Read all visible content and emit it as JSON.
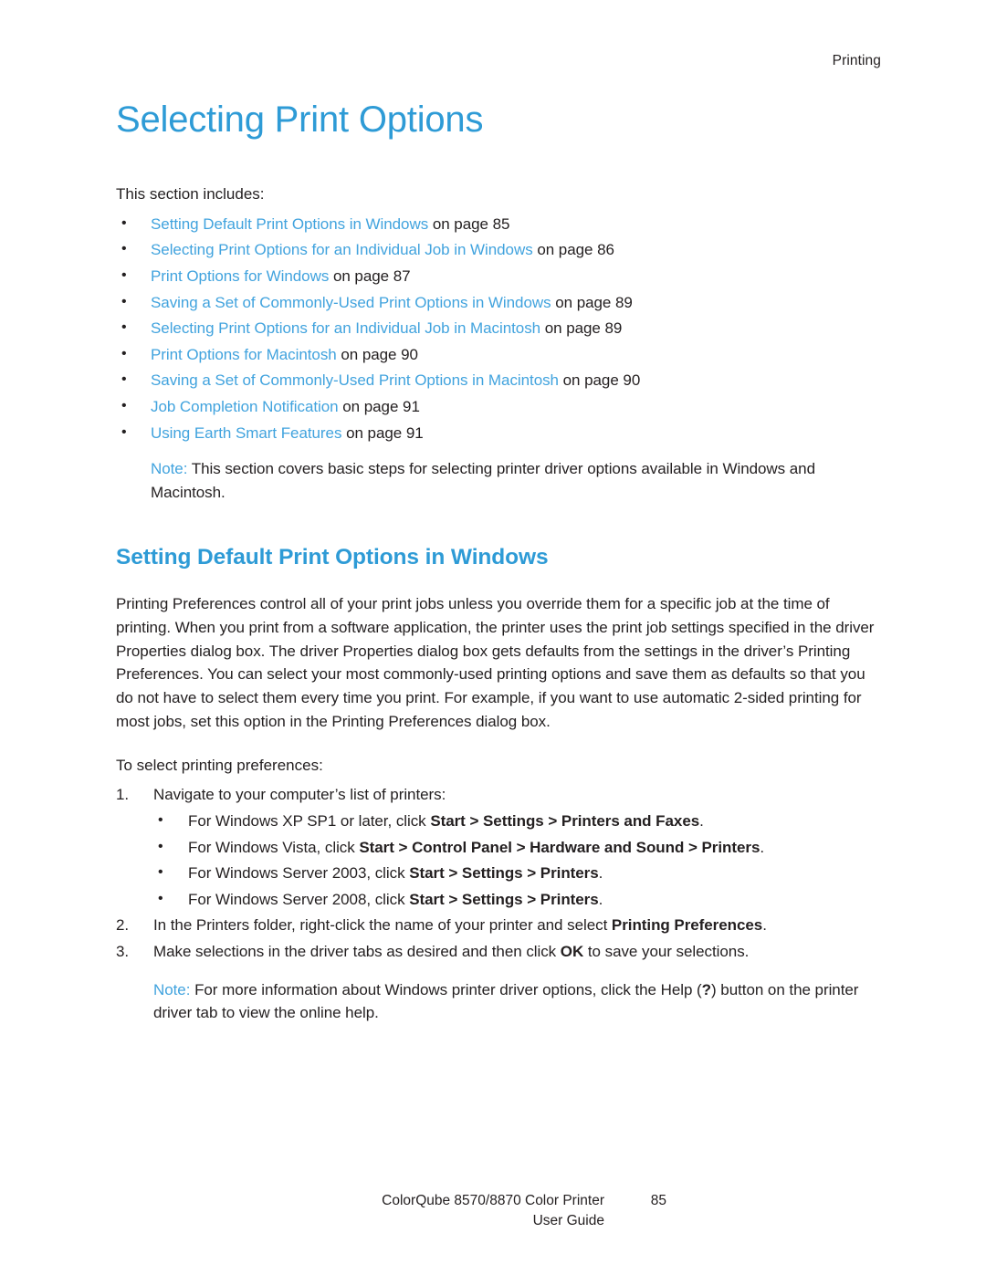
{
  "page": {
    "running_header": "Printing",
    "title": "Selecting Print Options",
    "intro": "This section includes:"
  },
  "toc": {
    "items": [
      {
        "link": "Setting Default Print Options in Windows",
        "tail": " on page 85"
      },
      {
        "link": "Selecting Print Options for an Individual Job in Windows",
        "tail": " on page 86"
      },
      {
        "link": "Print Options for Windows",
        "tail": " on page 87"
      },
      {
        "link": "Saving a Set of Commonly-Used Print Options in Windows",
        "tail": " on page 89"
      },
      {
        "link": "Selecting Print Options for an Individual Job in Macintosh",
        "tail": " on page 89"
      },
      {
        "link": "Print Options for Macintosh",
        "tail": " on page 90"
      },
      {
        "link": "Saving a Set of Commonly-Used Print Options in Macintosh",
        "tail": " on page 90"
      },
      {
        "link": "Job Completion Notification",
        "tail": " on page 91"
      },
      {
        "link": "Using Earth Smart Features",
        "tail": " on page 91"
      }
    ]
  },
  "intro_note": {
    "label": "Note:",
    "text": " This section covers basic steps for selecting printer driver options available in Windows and Macintosh."
  },
  "section": {
    "heading": "Setting Default Print Options in Windows",
    "paragraph": "Printing Preferences control all of your print jobs unless you override them for a specific job at the time of printing. When you print from a software application, the printer uses the print job settings specified in the driver Properties dialog box. The driver Properties dialog box gets defaults from the settings in the driver’s Printing Preferences. You can select your most commonly-used printing options and save them as defaults so that you do not have to select them every time you print. For example, if you want to use automatic 2-sided printing for most jobs, set this option in the Printing Preferences dialog box.",
    "procedure_lead": "To select printing preferences:"
  },
  "steps": [
    {
      "number": "1.",
      "text": "Navigate to your computer’s list of printers:",
      "sub_bullets": [
        {
          "pre": "For Windows XP SP1 or later, click ",
          "bold": "Start > Settings > Printers and Faxes",
          "post": "."
        },
        {
          "pre": "For Windows Vista, click ",
          "bold": "Start > Control Panel > Hardware and Sound > Printers",
          "post": "."
        },
        {
          "pre": "For Windows Server 2003, click ",
          "bold": "Start > Settings > Printers",
          "post": "."
        },
        {
          "pre": "For Windows Server 2008, click ",
          "bold": "Start > Settings > Printers",
          "post": "."
        }
      ]
    },
    {
      "number": "2.",
      "pre": "In the Printers folder, right-click the name of your printer and select ",
      "bold": "Printing Preferences",
      "post": "."
    },
    {
      "number": "3.",
      "pre": "Make selections in the driver tabs as desired and then click ",
      "bold": "OK",
      "post": " to save your selections."
    }
  ],
  "closing_note": {
    "label": "Note:",
    "pre": " For more information about Windows printer driver options, click the Help (",
    "bold": "?",
    "post": ") button on the printer driver tab to view the online help."
  },
  "footer": {
    "line1": "ColorQube 8570/8870 Color Printer",
    "line2": "User Guide",
    "page_number": "85"
  },
  "colors": {
    "heading_blue": "#2e9bd6",
    "link_blue": "#41a3de",
    "body_text": "#231f20"
  }
}
